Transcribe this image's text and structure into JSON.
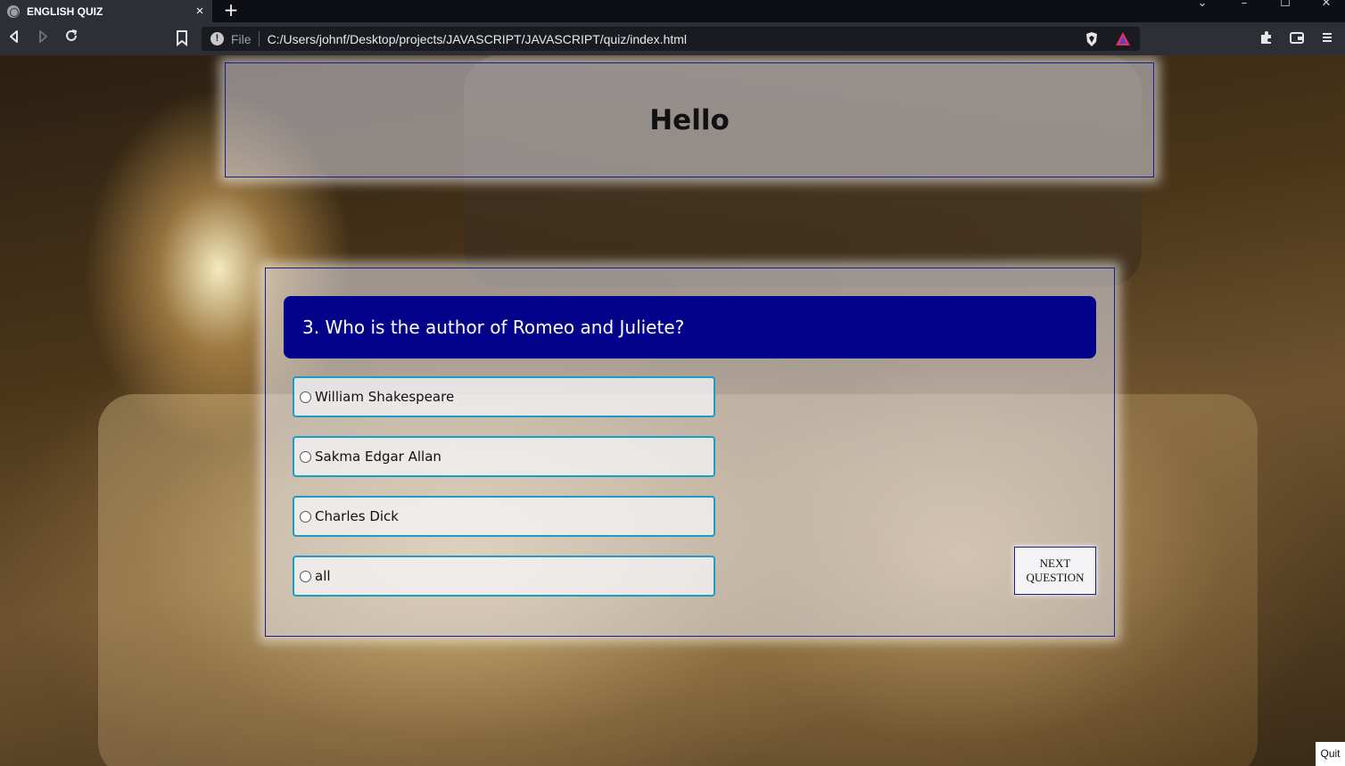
{
  "browser": {
    "tab_title": "ENGLISH QUIZ",
    "tab_close": "×",
    "new_tab": "+",
    "file_label": "File",
    "url": "C:/Users/johnf/Desktop/projects/JAVASCRIPT/JAVASCRIPT/quiz/index.html"
  },
  "header": {
    "title": "Hello"
  },
  "quiz": {
    "question": "3. Who is the author of Romeo and Juliete?",
    "options": [
      "William Shakespeare",
      "Sakma Edgar Allan",
      "Charles Dick",
      "all"
    ],
    "next_label": "NEXT QUESTION"
  },
  "quit_label": "Quit",
  "colors": {
    "question_bg": "#02028a",
    "option_border": "#1a9dc4"
  }
}
